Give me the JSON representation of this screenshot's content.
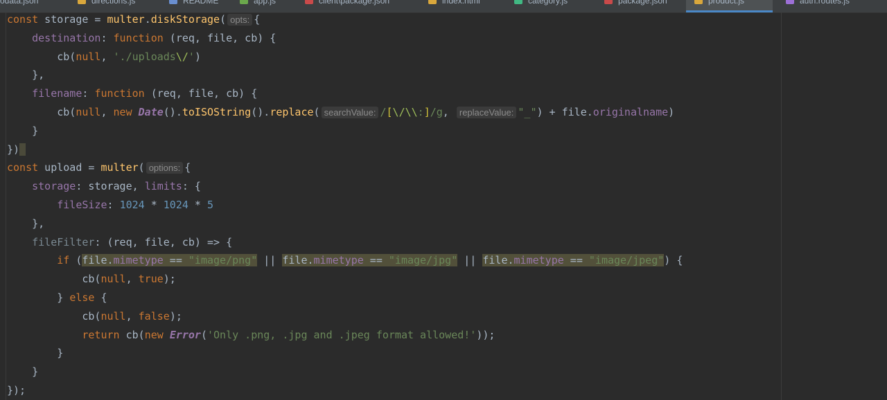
{
  "tabs": [
    {
      "label": "odata.json",
      "icon": "json-file-icon",
      "iconColor": "#c9a449"
    },
    {
      "label": "directions.js",
      "icon": "js-file-icon",
      "iconColor": "#d9a73c"
    },
    {
      "label": "README",
      "icon": "markdown-file-icon",
      "iconColor": "#6a8fd0"
    },
    {
      "label": "app.js",
      "icon": "node-file-icon",
      "iconColor": "#6ba84c"
    },
    {
      "label": "client\\package.json",
      "icon": "npm-file-icon",
      "iconColor": "#c94a4a"
    },
    {
      "label": "index.html",
      "icon": "js-file-icon",
      "iconColor": "#d9a73c"
    },
    {
      "label": "category.js",
      "icon": "vue-file-icon",
      "iconColor": "#41b883"
    },
    {
      "label": "package.json",
      "icon": "npm-file-icon",
      "iconColor": "#c94a4a"
    },
    {
      "label": "product.js",
      "icon": "js-file-icon",
      "iconColor": "#d9a73c",
      "active": true
    },
    {
      "label": "auth.routes.js",
      "icon": "js-file-icon",
      "iconColor": "#9c6fd6"
    }
  ],
  "lines": [
    [
      [
        "kw",
        "const"
      ],
      [
        "op",
        " storage = "
      ],
      [
        "fn",
        "multer"
      ],
      [
        "op",
        "."
      ],
      [
        "fn",
        "diskStorage"
      ],
      [
        "op",
        "("
      ],
      [
        "hint",
        "opts:"
      ],
      [
        "op",
        "{"
      ]
    ],
    [
      [
        "op",
        "    "
      ],
      [
        "prop",
        "destination"
      ],
      [
        "op",
        ": "
      ],
      [
        "kw",
        "function"
      ],
      [
        "op",
        " (req, file, cb) {"
      ]
    ],
    [
      [
        "op",
        "        cb("
      ],
      [
        "kw",
        "null"
      ],
      [
        "op",
        ", "
      ],
      [
        "str",
        "'./uploads"
      ],
      [
        "rxesc",
        "\\/"
      ],
      [
        "str",
        "'"
      ],
      [
        "op",
        ")"
      ]
    ],
    [
      [
        "op",
        "    },"
      ]
    ],
    [
      [
        "op",
        "    "
      ],
      [
        "prop",
        "filename"
      ],
      [
        "op",
        ": "
      ],
      [
        "kw",
        "function"
      ],
      [
        "op",
        " (req, file, cb) {"
      ]
    ],
    [
      [
        "op",
        "        cb("
      ],
      [
        "kw",
        "null"
      ],
      [
        "op",
        ", "
      ],
      [
        "kw",
        "new "
      ],
      [
        "cls",
        "Date"
      ],
      [
        "op",
        "()."
      ],
      [
        "fn",
        "toISOString"
      ],
      [
        "op",
        "()."
      ],
      [
        "fn",
        "replace"
      ],
      [
        "op",
        "("
      ],
      [
        "hint",
        "searchValue:"
      ],
      [
        "rx",
        "/"
      ],
      [
        "rxbr",
        "["
      ],
      [
        "rxesc",
        "\\/\\\\"
      ],
      [
        "rx",
        ":"
      ],
      [
        "rxbr",
        "]"
      ],
      [
        "rx",
        "/g"
      ],
      [
        "op",
        ", "
      ],
      [
        "hint",
        "replaceValue:"
      ],
      [
        "str",
        "\"_\""
      ],
      [
        "op",
        ") + file."
      ],
      [
        "prop",
        "originalname"
      ],
      [
        "op",
        ")"
      ]
    ],
    [
      [
        "op",
        "    }"
      ]
    ],
    [
      [
        "op",
        "})"
      ],
      [
        "caret",
        " "
      ]
    ],
    [
      [
        "kw",
        "const"
      ],
      [
        "op",
        " upload = "
      ],
      [
        "fn",
        "multer"
      ],
      [
        "op",
        "("
      ],
      [
        "hint",
        "options:"
      ],
      [
        "op",
        "{"
      ]
    ],
    [
      [
        "op",
        "    "
      ],
      [
        "prop",
        "storage"
      ],
      [
        "op",
        ": storage, "
      ],
      [
        "prop",
        "limits"
      ],
      [
        "op",
        ": {"
      ]
    ],
    [
      [
        "op",
        "        "
      ],
      [
        "prop",
        "fileSize"
      ],
      [
        "op",
        ": "
      ],
      [
        "num",
        "1024"
      ],
      [
        "op",
        " * "
      ],
      [
        "num",
        "1024"
      ],
      [
        "op",
        " * "
      ],
      [
        "num",
        "5"
      ]
    ],
    [
      [
        "op",
        "    },"
      ]
    ],
    [
      [
        "op",
        "    "
      ],
      [
        "dim",
        "fileFilter"
      ],
      [
        "op",
        ": (req, file, cb) => {"
      ]
    ],
    [
      [
        "op",
        "        "
      ],
      [
        "kw",
        "if"
      ],
      [
        "op",
        " ("
      ],
      [
        "hlop",
        "file."
      ],
      [
        "hlprop",
        "mimetype"
      ],
      [
        "hlop",
        " == "
      ],
      [
        "hlstr",
        "\"image/png\""
      ],
      [
        "op",
        " || "
      ],
      [
        "hlop",
        "file."
      ],
      [
        "hlprop",
        "mimetype"
      ],
      [
        "hlop",
        " == "
      ],
      [
        "hlstr",
        "\"image/jpg\""
      ],
      [
        "op",
        " || "
      ],
      [
        "hlop",
        "file."
      ],
      [
        "hlprop",
        "mimetype"
      ],
      [
        "hlop",
        " == "
      ],
      [
        "hlstr",
        "\"image/jpeg\""
      ],
      [
        "op",
        ") {"
      ]
    ],
    [
      [
        "op",
        "            cb("
      ],
      [
        "kw",
        "null"
      ],
      [
        "op",
        ", "
      ],
      [
        "kw",
        "true"
      ],
      [
        "op",
        ");"
      ]
    ],
    [
      [
        "op",
        "        } "
      ],
      [
        "kw",
        "else"
      ],
      [
        "op",
        " {"
      ]
    ],
    [
      [
        "op",
        "            cb("
      ],
      [
        "kw",
        "null"
      ],
      [
        "op",
        ", "
      ],
      [
        "kw",
        "false"
      ],
      [
        "op",
        ");"
      ]
    ],
    [
      [
        "op",
        "            "
      ],
      [
        "kw",
        "return"
      ],
      [
        "op",
        " cb("
      ],
      [
        "kw",
        "new "
      ],
      [
        "cls",
        "Error"
      ],
      [
        "op",
        "("
      ],
      [
        "str",
        "'Only .png, .jpg and .jpeg format allowed!'"
      ],
      [
        "op",
        "));"
      ]
    ],
    [
      [
        "op",
        "        }"
      ]
    ],
    [
      [
        "op",
        "    }"
      ]
    ],
    [
      [
        "op",
        "});"
      ]
    ]
  ]
}
